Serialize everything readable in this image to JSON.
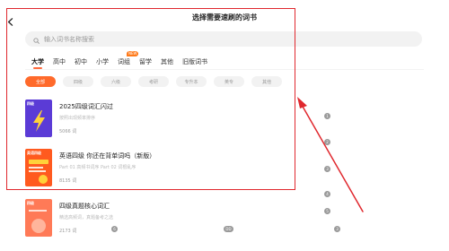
{
  "header": {
    "title": "选择需要速刷的词书"
  },
  "search": {
    "placeholder": "输入词书名称搜索"
  },
  "tabs": [
    {
      "label": "大学",
      "active": true
    },
    {
      "label": "高中"
    },
    {
      "label": "初中"
    },
    {
      "label": "小学"
    },
    {
      "label": "词组",
      "badge": "NEW"
    },
    {
      "label": "留学"
    },
    {
      "label": "其他"
    },
    {
      "label": "旧版词书"
    }
  ],
  "chips": [
    "全部",
    "四级",
    "六级",
    "考研",
    "专升本",
    "英专",
    "其他"
  ],
  "books": [
    {
      "title": "2025四级词汇闪过",
      "desc": "按照出现频率排序",
      "count": "5066 词",
      "cover_label": "四级",
      "cover_color": "#5b3bd6"
    },
    {
      "title": "英语四级 你还在背单词吗（新版）",
      "desc": "Part 01 高频书词序 Part 02 词根乱序",
      "count": "8135 词",
      "cover_label": "英语四级",
      "cover_color": "#ff5a1f"
    },
    {
      "title": "四级真题核心词汇",
      "desc": "精选高频词，真题备考之选",
      "count": "2173 词",
      "cover_label": "四级",
      "cover_color": "#ff7a57"
    }
  ],
  "markers": [
    "1",
    "2",
    "3",
    "4",
    "5",
    "6",
    "DD",
    "3"
  ],
  "colors": {
    "accent": "#ff6a2b",
    "highlight_border": "#e0282e",
    "arrow": "#e0282e"
  }
}
